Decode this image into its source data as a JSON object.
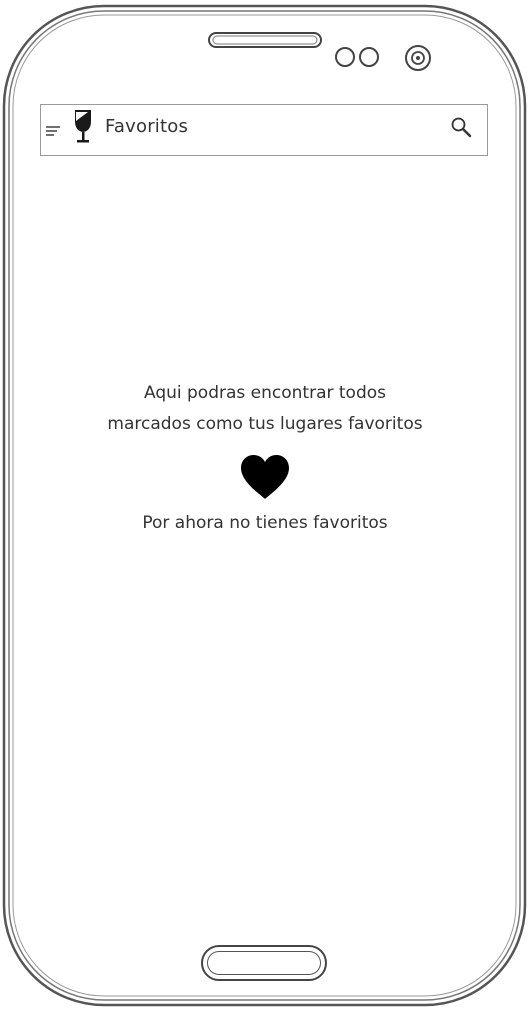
{
  "app_bar": {
    "title": "Favoritos",
    "menu_icon": "menu-icon",
    "logo_icon": "wine-glass-logo-icon",
    "search_icon": "search-icon"
  },
  "empty_state": {
    "message_line1": "Aqui podras encontrar todos",
    "message_line2": "marcados como tus lugares favoritos",
    "icon": "heart-icon",
    "subtitle": "Por ahora no tienes favoritos"
  },
  "colors": {
    "ink": "#333333",
    "outline": "#555555",
    "heart": "#000000"
  }
}
